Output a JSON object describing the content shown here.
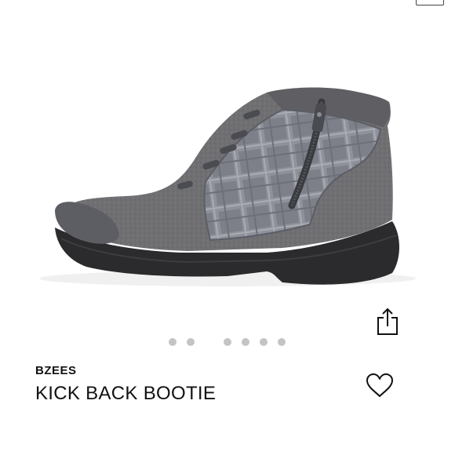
{
  "product": {
    "brand": "BZEES",
    "name": "KICK BACK BOOTIE",
    "image_alt": "Grey felt ankle bootie with plaid side panel and zipper"
  },
  "gallery": {
    "total_images": 7,
    "active_index": 0
  },
  "icons": {
    "share": "share-icon",
    "favorite": "heart-outline-icon"
  },
  "colors": {
    "dot_inactive": "#c4c4c4",
    "text": "#111111"
  }
}
